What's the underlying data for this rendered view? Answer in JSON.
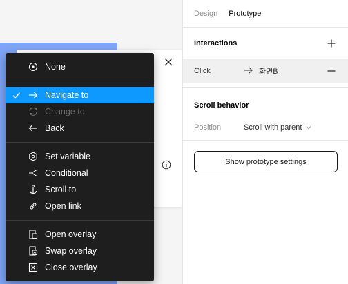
{
  "sidebar": {
    "tabs": [
      {
        "label": "Design"
      },
      {
        "label": "Prototype"
      }
    ],
    "interactions": {
      "title": "Interactions",
      "rows": [
        {
          "trigger": "Click",
          "target": "화면B"
        }
      ]
    },
    "scroll": {
      "title": "Scroll behavior",
      "position_label": "Position",
      "position_value": "Scroll with parent"
    },
    "prototype_settings_button": "Show prototype settings"
  },
  "menu": {
    "groups": [
      [
        {
          "label": "None",
          "icon": "circle-dot-icon"
        }
      ],
      [
        {
          "label": "Navigate to",
          "icon": "arrow-right-icon",
          "selected": true
        },
        {
          "label": "Change to",
          "icon": "swap-arrows-icon",
          "disabled": true
        },
        {
          "label": "Back",
          "icon": "arrow-left-icon"
        }
      ],
      [
        {
          "label": "Set variable",
          "icon": "hexagon-icon"
        },
        {
          "label": "Conditional",
          "icon": "branch-icon"
        },
        {
          "label": "Scroll to",
          "icon": "anchor-icon"
        },
        {
          "label": "Open link",
          "icon": "link-icon"
        }
      ],
      [
        {
          "label": "Open overlay",
          "icon": "open-overlay-icon"
        },
        {
          "label": "Swap overlay",
          "icon": "swap-overlay-icon"
        },
        {
          "label": "Close overlay",
          "icon": "close-overlay-icon"
        }
      ]
    ]
  },
  "colors": {
    "accent": "#0d99ff",
    "menu_bg": "#1e1e1e",
    "frame_blue": "#7ea5f8"
  }
}
